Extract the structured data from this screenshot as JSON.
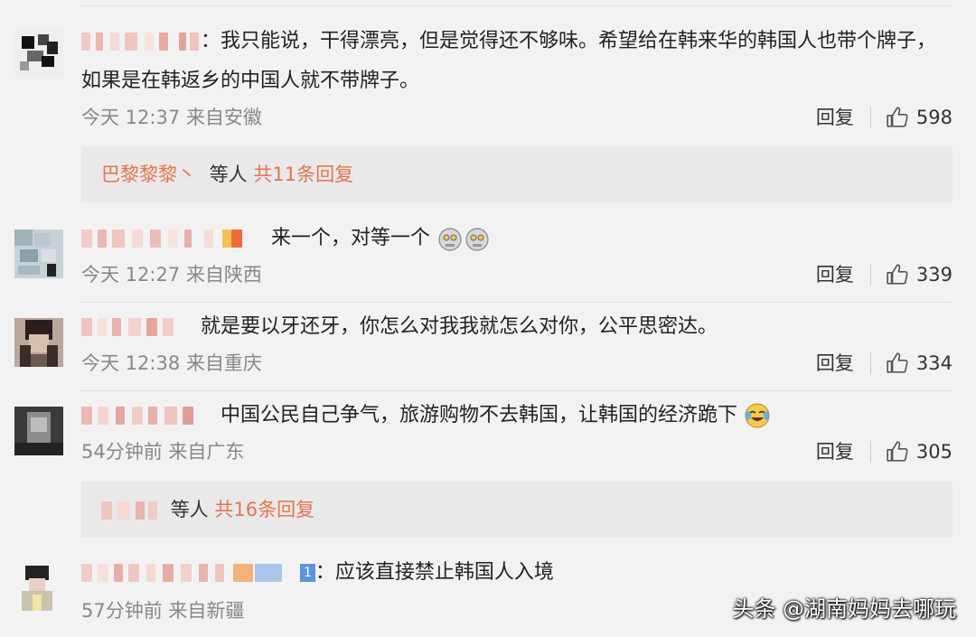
{
  "comments": [
    {
      "text": "：我只能说，干得漂亮，但是觉得还不够味。希望给在韩来华的韩国人也带个牌子，",
      "text2": "如果是在韩返乡的中国人就不带牌子。",
      "time": "今天 12:37",
      "location": "来自安徽",
      "reply_label": "回复",
      "likes": "598"
    },
    {
      "text": "来一个，对等一个",
      "time": "今天 12:27",
      "location": "来自陕西",
      "reply_label": "回复",
      "likes": "339"
    },
    {
      "text": "就是要以牙还牙，你怎么对我我就怎么对你，公平思密达。",
      "time": "今天 12:38",
      "location": "来自重庆",
      "reply_label": "回复",
      "likes": "334"
    },
    {
      "text": "中国公民自己争气，旅游购物不去韩国，让韩国的经济跪下",
      "time": "54分钟前",
      "location": "来自广东",
      "reply_label": "回复",
      "likes": "305"
    },
    {
      "text": "：应该直接禁止韩国人入境",
      "time": "57分钟前",
      "location": "来自新疆"
    }
  ],
  "reply_threads": [
    {
      "replier": "巴黎黎黎丶",
      "etc": "等人",
      "total": "共11条回复"
    },
    {
      "etc": "等人",
      "total": "共16条回复"
    }
  ],
  "badge_level": "1",
  "watermark": "头条 @湖南妈妈去哪玩",
  "colors": {
    "accent": "#e5744d",
    "meta": "#888888",
    "background": "#f2f2f2"
  }
}
